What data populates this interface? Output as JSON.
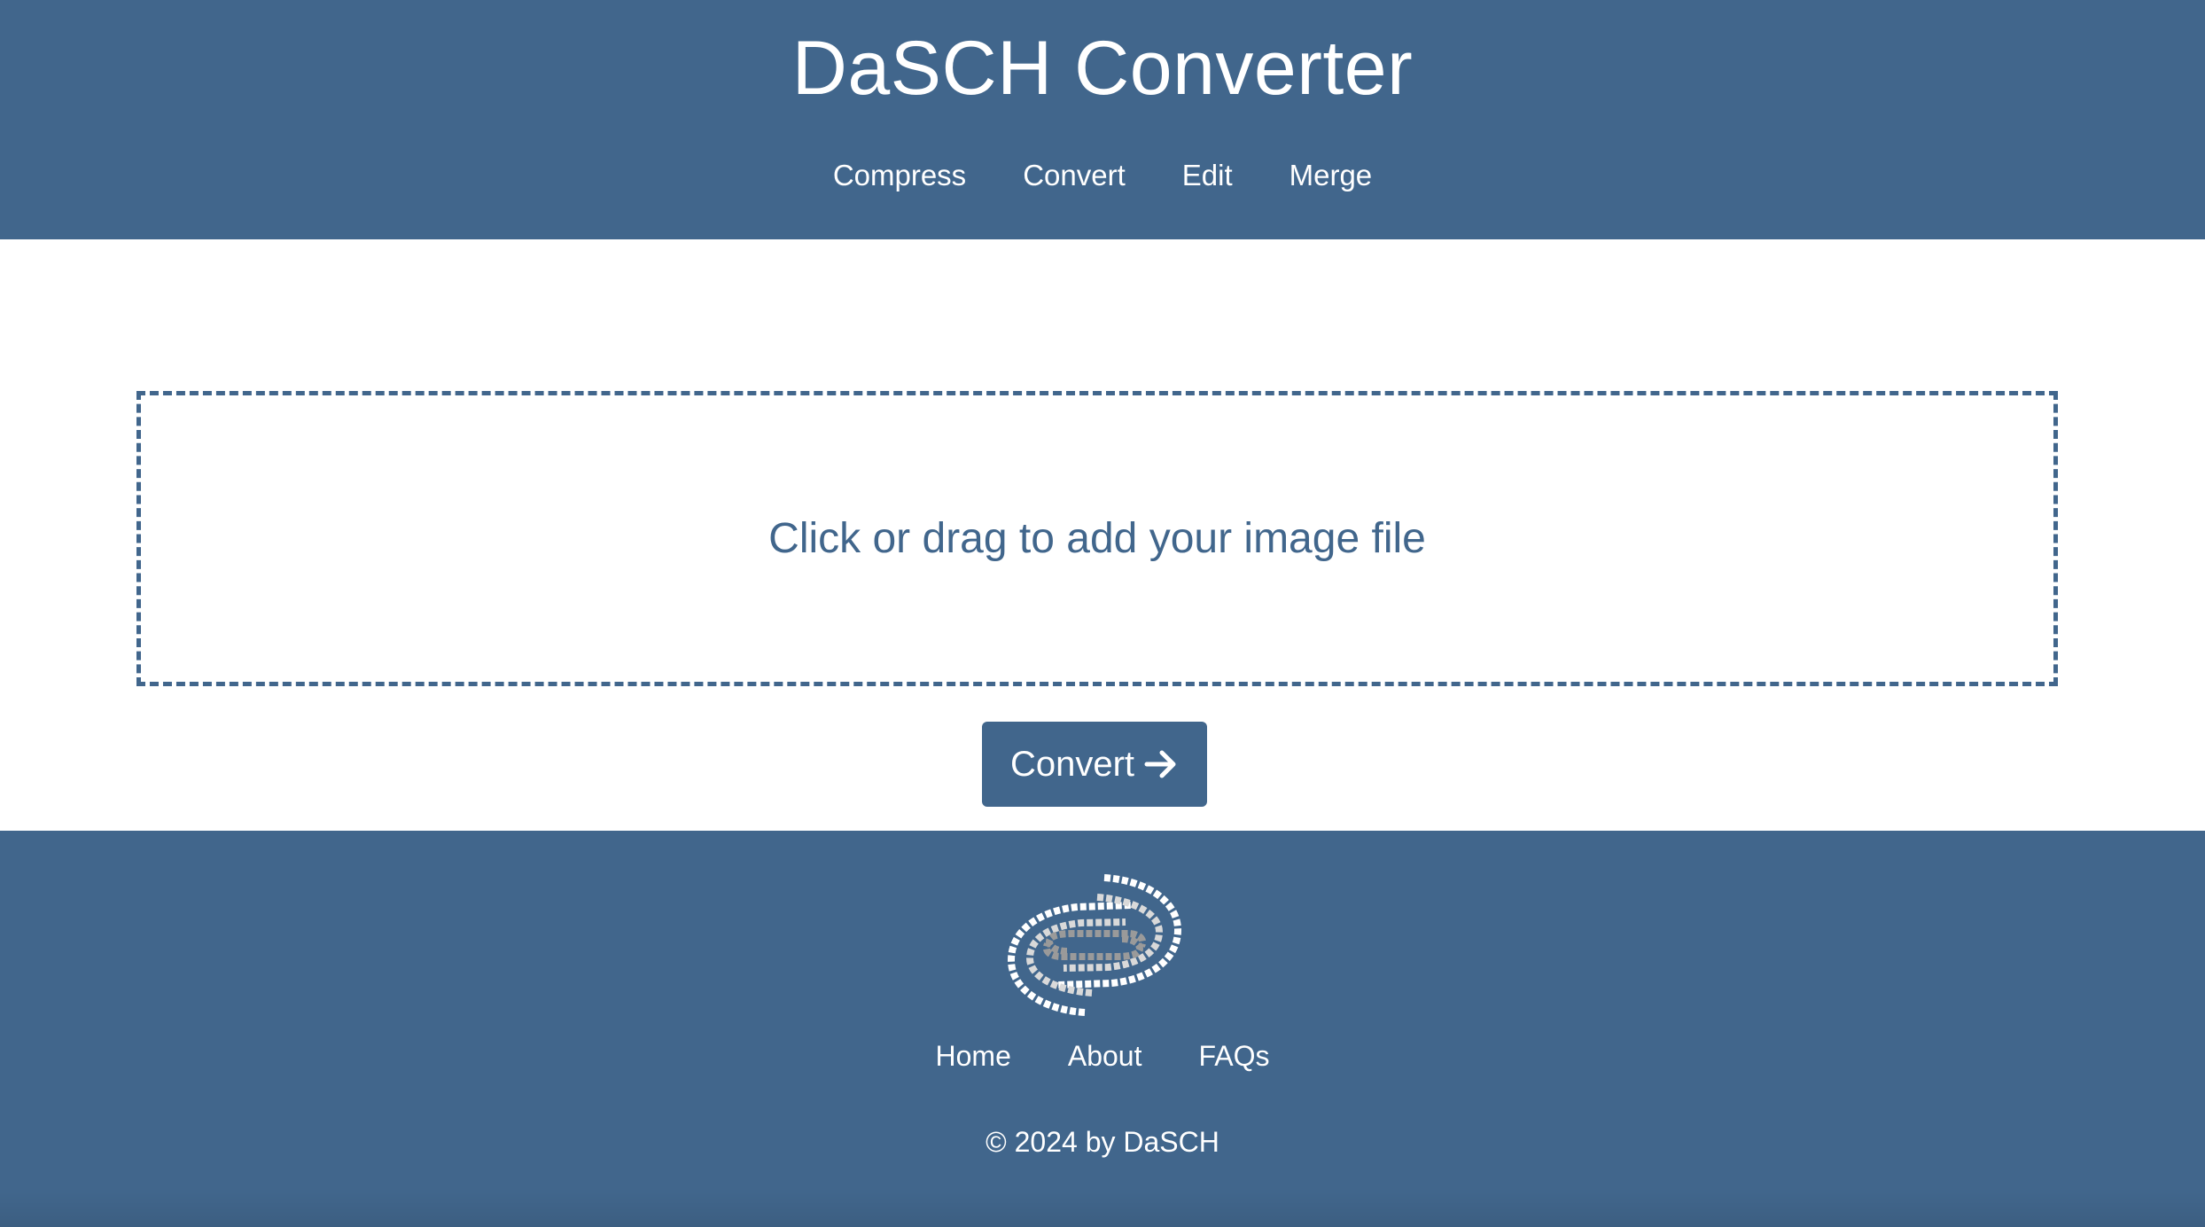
{
  "header": {
    "title": "DaSCH Converter",
    "nav": [
      "Compress",
      "Convert",
      "Edit",
      "Merge"
    ]
  },
  "upload": {
    "prompt": "Click or drag to add your image file"
  },
  "actions": {
    "convert_label": "Convert",
    "convert_icon": "arrow-right-icon"
  },
  "footer": {
    "logo": "dasch-logo",
    "nav": [
      "Home",
      "About",
      "FAQs"
    ],
    "copyright": "© 2024 by DaSCH"
  },
  "colors": {
    "brand": "#41668c",
    "background": "#ffffff",
    "text_on_brand": "#ffffff"
  }
}
